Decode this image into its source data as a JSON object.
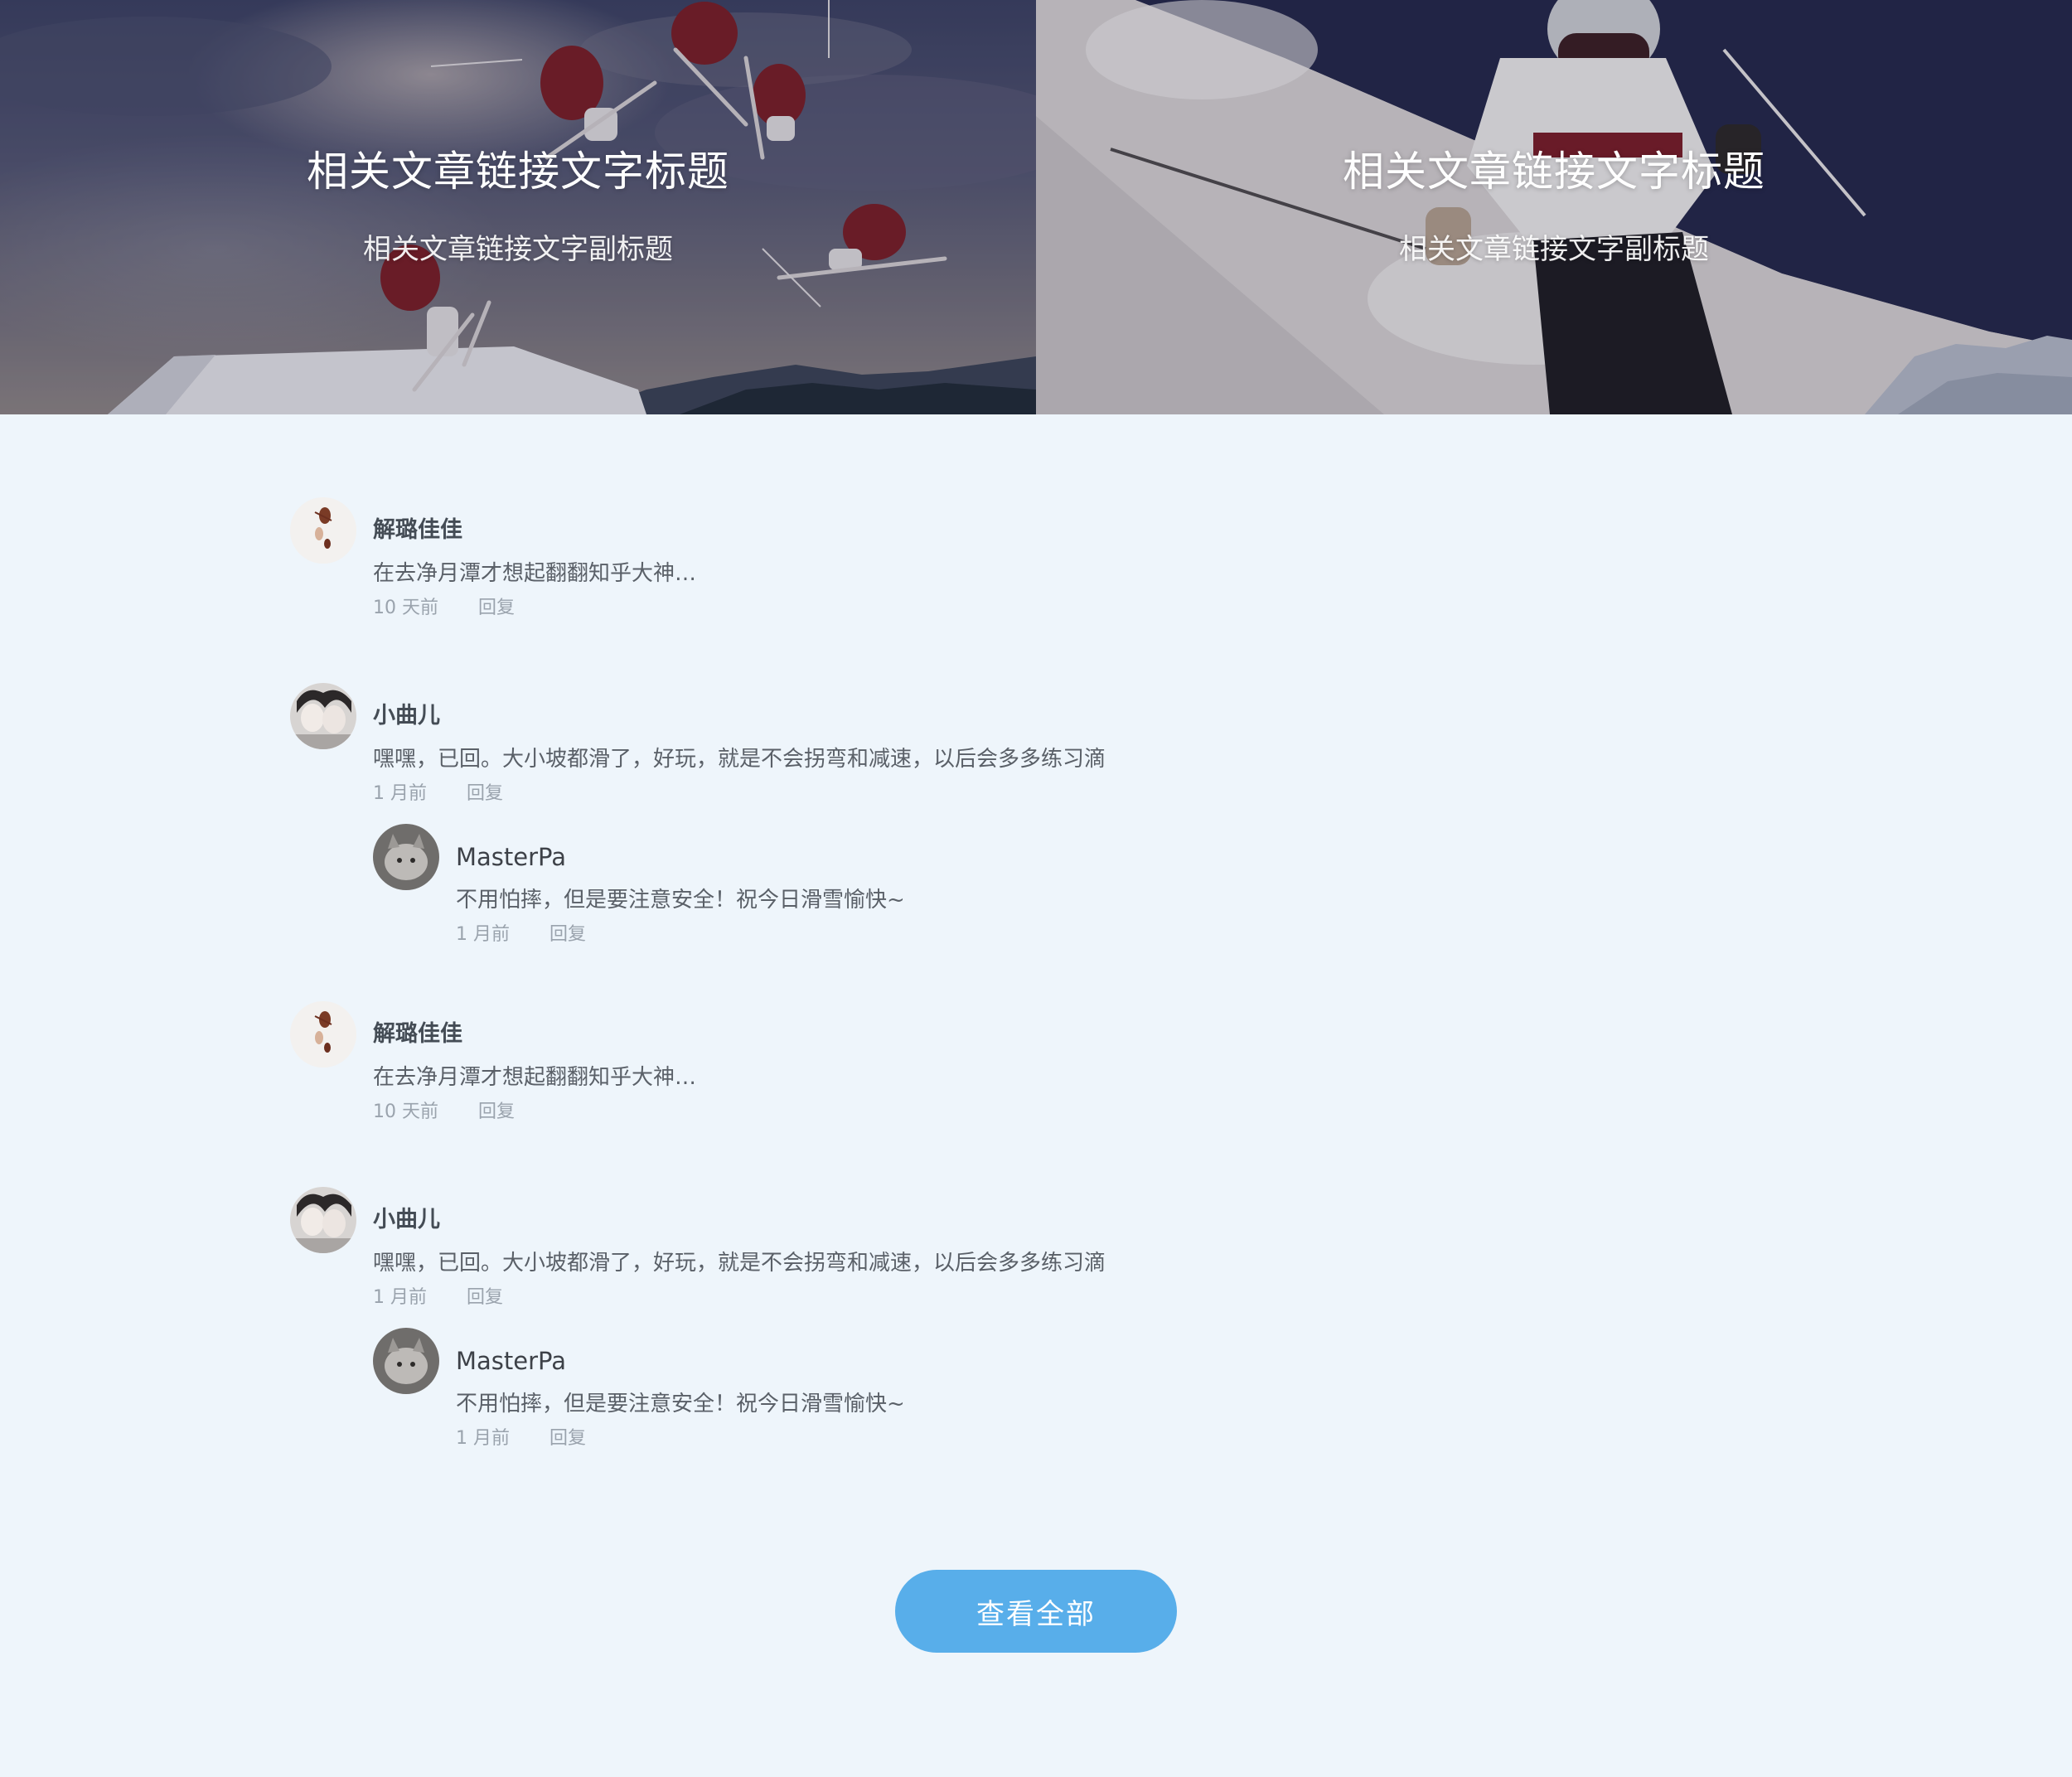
{
  "banner": {
    "cards": [
      {
        "title": "相关文章链接文字标题",
        "subtitle": "相关文章链接文字副标题",
        "image": "freestyle-skiers-jumping"
      },
      {
        "title": "相关文章链接文字标题",
        "subtitle": "相关文章链接文字副标题",
        "image": "skier-carving-slope"
      }
    ]
  },
  "comments": [
    {
      "name": "解璐佳佳",
      "text": "在去净月潭才想起翻翻知乎大神…",
      "time": "10 天前",
      "reply_label": "回复",
      "avatar": "avatar-figurine"
    },
    {
      "name": "小曲儿",
      "text": "嘿嘿，已回。大小坡都滑了，好玩，就是不会拐弯和减速，以后会多多练习滴",
      "time": "1 月前",
      "reply_label": "回复",
      "avatar": "avatar-girls-photo",
      "reply": {
        "name": "MasterPa",
        "text": "不用怕摔，但是要注意安全！祝今日滑雪愉快~",
        "time": "1 月前",
        "reply_label": "回复",
        "avatar": "avatar-cat-photo"
      }
    },
    {
      "name": "解璐佳佳",
      "text": "在去净月潭才想起翻翻知乎大神…",
      "time": "10 天前",
      "reply_label": "回复",
      "avatar": "avatar-figurine"
    },
    {
      "name": "小曲儿",
      "text": "嘿嘿，已回。大小坡都滑了，好玩，就是不会拐弯和减速，以后会多多练习滴",
      "time": "1 月前",
      "reply_label": "回复",
      "avatar": "avatar-girls-photo",
      "reply": {
        "name": "MasterPa",
        "text": "不用怕摔，但是要注意安全！祝今日滑雪愉快~",
        "time": "1 月前",
        "reply_label": "回复",
        "avatar": "avatar-cat-photo"
      }
    }
  ],
  "view_all_label": "查看全部",
  "colors": {
    "page_background": "#eef5fb",
    "button": "#58aeea",
    "meta_text": "#9aa3ad"
  }
}
